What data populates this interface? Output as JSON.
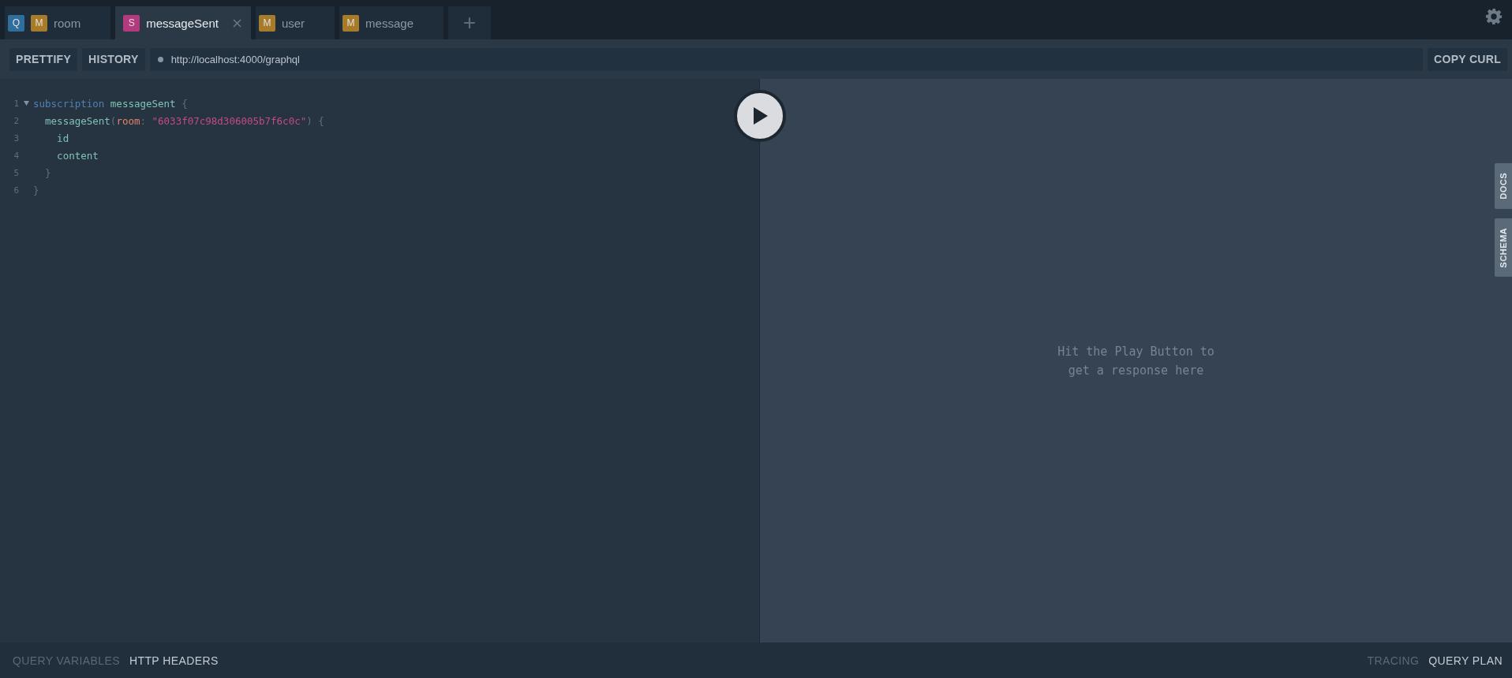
{
  "tabs": [
    {
      "badges": [
        {
          "kind": "query",
          "text": "Q"
        },
        {
          "kind": "mutation",
          "text": "M"
        }
      ],
      "label": "room",
      "selected": false,
      "closable": false
    },
    {
      "badges": [
        {
          "kind": "subscription",
          "text": "S"
        }
      ],
      "label": "messageSent",
      "selected": true,
      "closable": true
    },
    {
      "badges": [
        {
          "kind": "mutation",
          "text": "M"
        }
      ],
      "label": "user",
      "selected": false,
      "closable": false
    },
    {
      "badges": [
        {
          "kind": "mutation",
          "text": "M"
        }
      ],
      "label": "message",
      "selected": false,
      "closable": false
    }
  ],
  "new_tab": "+",
  "toolbar": {
    "buttons": [
      "PRETTIFY",
      "HISTORY"
    ],
    "url": "http://localhost:4000/graphql",
    "copy_curl": "COPY CURL"
  },
  "editor": {
    "lines": [
      {
        "number": "1",
        "foldable": true,
        "tokens": [
          {
            "kind": "keyword",
            "text": "subscription "
          },
          {
            "kind": "def",
            "text": "messageSent "
          },
          {
            "kind": "punct",
            "text": "{"
          }
        ]
      },
      {
        "number": "2",
        "foldable": false,
        "tokens": [
          {
            "kind": "field",
            "text": "  messageSent"
          },
          {
            "kind": "punct",
            "text": "("
          },
          {
            "kind": "arg",
            "text": "room"
          },
          {
            "kind": "punct",
            "text": ": "
          },
          {
            "kind": "string",
            "text": "\"6033f07c98d306005b7f6c0c\""
          },
          {
            "kind": "punct",
            "text": ") {"
          }
        ]
      },
      {
        "number": "3",
        "foldable": false,
        "tokens": [
          {
            "kind": "field",
            "text": "    id"
          }
        ]
      },
      {
        "number": "4",
        "foldable": false,
        "tokens": [
          {
            "kind": "field",
            "text": "    content"
          }
        ]
      },
      {
        "number": "5",
        "foldable": false,
        "tokens": [
          {
            "kind": "punct",
            "text": "  }"
          }
        ]
      },
      {
        "number": "6",
        "foldable": false,
        "tokens": [
          {
            "kind": "punct",
            "text": "}"
          }
        ]
      }
    ]
  },
  "result": {
    "message": "Hit the Play Button to\nget a response here"
  },
  "side_tabs": [
    "DOCS",
    "SCHEMA"
  ],
  "bottom_left": [
    {
      "label": "QUERY VARIABLES",
      "selected": false
    },
    {
      "label": "HTTP HEADERS",
      "selected": true
    }
  ],
  "bottom_right": [
    {
      "label": "TRACING",
      "selected": false
    },
    {
      "label": "QUERY PLAN",
      "selected": true
    }
  ]
}
